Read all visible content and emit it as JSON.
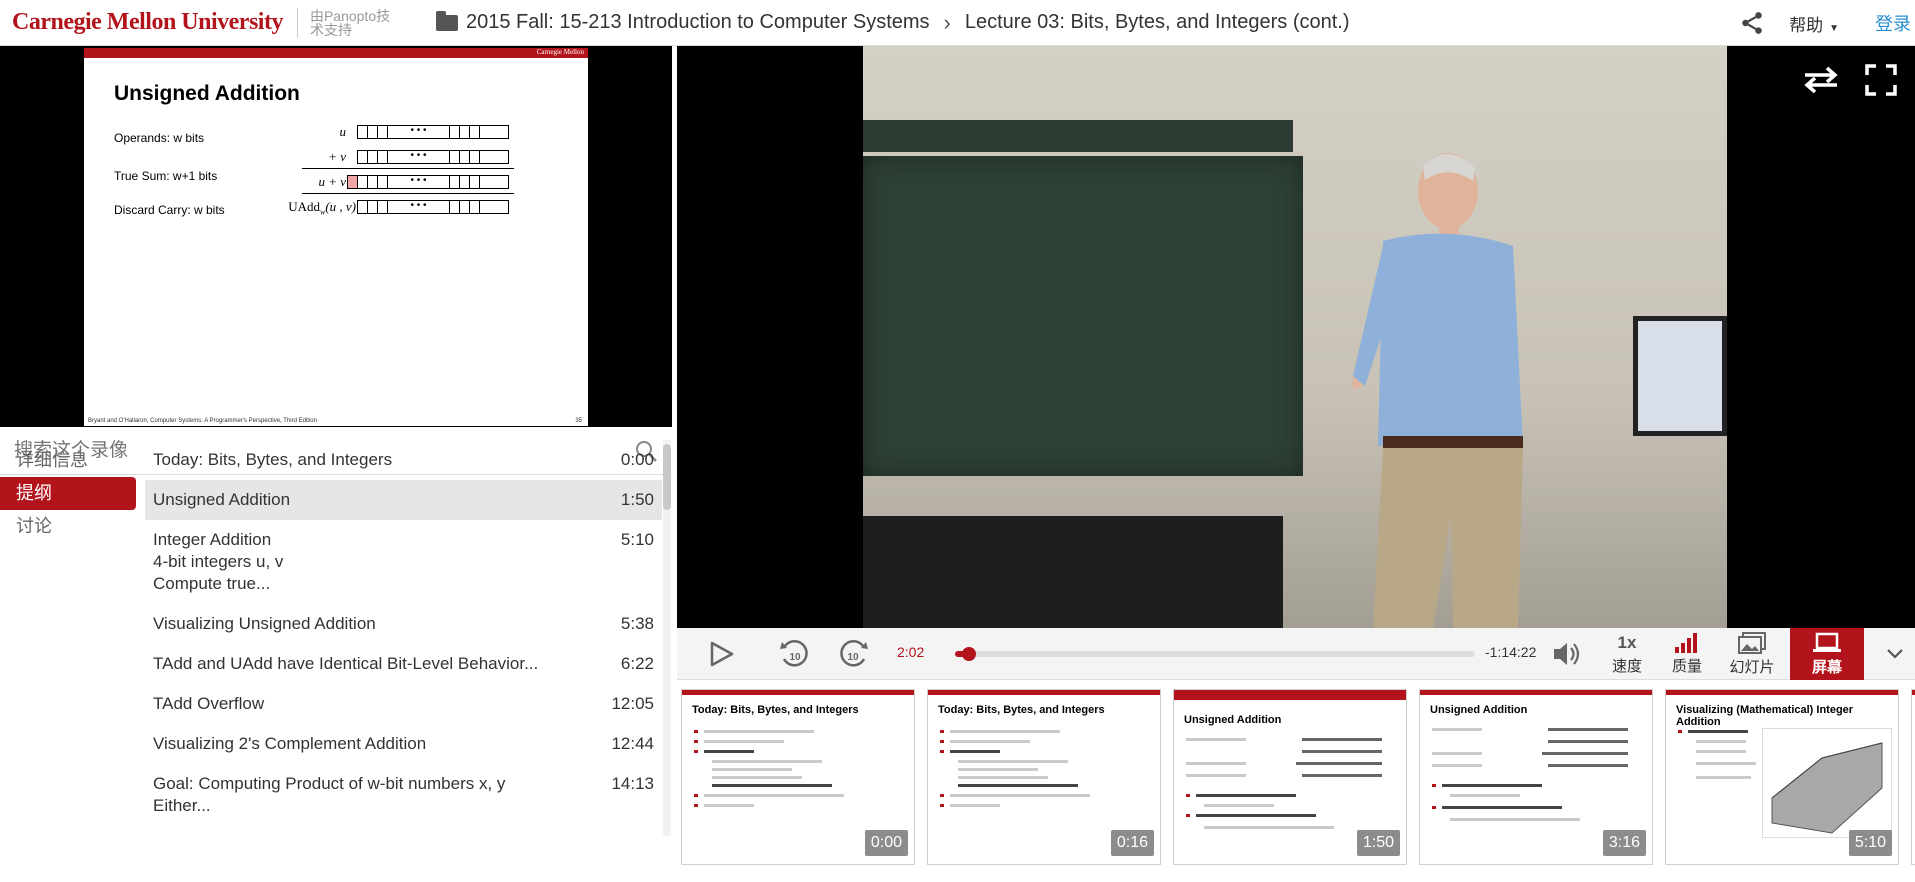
{
  "header": {
    "logo": "Carnegie Mellon University",
    "powered_by": "由Panopto技术支持",
    "folder": "2015 Fall: 15-213 Introduction to Computer Systems",
    "lecture": "Lecture 03: Bits, Bytes, and Integers (cont.)",
    "help": "帮助",
    "login": "登录"
  },
  "slide": {
    "brand": "Carnegie Mellon",
    "title": "Unsigned Addition",
    "rows": [
      "Operands: w bits",
      "True Sum: w+1 bits",
      "Discard Carry: w bits"
    ],
    "vars": [
      "u",
      "+ v",
      "u + v",
      "UAdd"
    ],
    "uadd_args": "(u , v)",
    "uadd_sub": "w",
    "dots": "• • •",
    "footer": "Bryant and O'Hallaron, Computer Systems: A Programmer's Perspective, Third Edition",
    "page": "35"
  },
  "search": {
    "placeholder": "搜索这个录像"
  },
  "tabs": [
    "详细信息",
    "提纲",
    "讨论"
  ],
  "outline": [
    {
      "title": "Today: Bits, Bytes, and Integers",
      "sub": [],
      "time": "0:00"
    },
    {
      "title": "Unsigned Addition",
      "sub": [],
      "time": "1:50"
    },
    {
      "title": "Integer Addition",
      "sub": [
        "4-bit integers u, v",
        "Compute true..."
      ],
      "time": "5:10"
    },
    {
      "title": "Visualizing Unsigned Addition",
      "sub": [],
      "time": "5:38"
    },
    {
      "title": "TAdd and UAdd have Identical Bit-Level Behavior...",
      "sub": [],
      "time": "6:22"
    },
    {
      "title": "TAdd Overflow",
      "sub": [],
      "time": "12:05"
    },
    {
      "title": "Visualizing 2's Complement Addition",
      "sub": [],
      "time": "12:44"
    },
    {
      "title": "Goal: Computing Product of w-bit numbers x, y",
      "sub": [
        "Either..."
      ],
      "time": "14:13"
    }
  ],
  "player": {
    "elapsed": "2:02",
    "remaining": "-1:14:22",
    "progress_fraction": 0.026,
    "speed": "1x",
    "speed_label": "速度",
    "quality_label": "质量",
    "slides_label": "幻灯片",
    "screen_label": "屏幕"
  },
  "thumbnails": [
    {
      "title": "Today: Bits, Bytes, and Integers",
      "time": "0:00"
    },
    {
      "title": "Today: Bits, Bytes, and Integers",
      "time": "0:16"
    },
    {
      "title": "Unsigned Addition",
      "time": "1:50"
    },
    {
      "title": "Unsigned Addition",
      "time": "3:16"
    },
    {
      "title": "Visualizing (Mathematical) Integer Addition",
      "time": "5:10"
    }
  ],
  "colors": {
    "brand": "#b3141c",
    "link": "#2a8fd0"
  }
}
